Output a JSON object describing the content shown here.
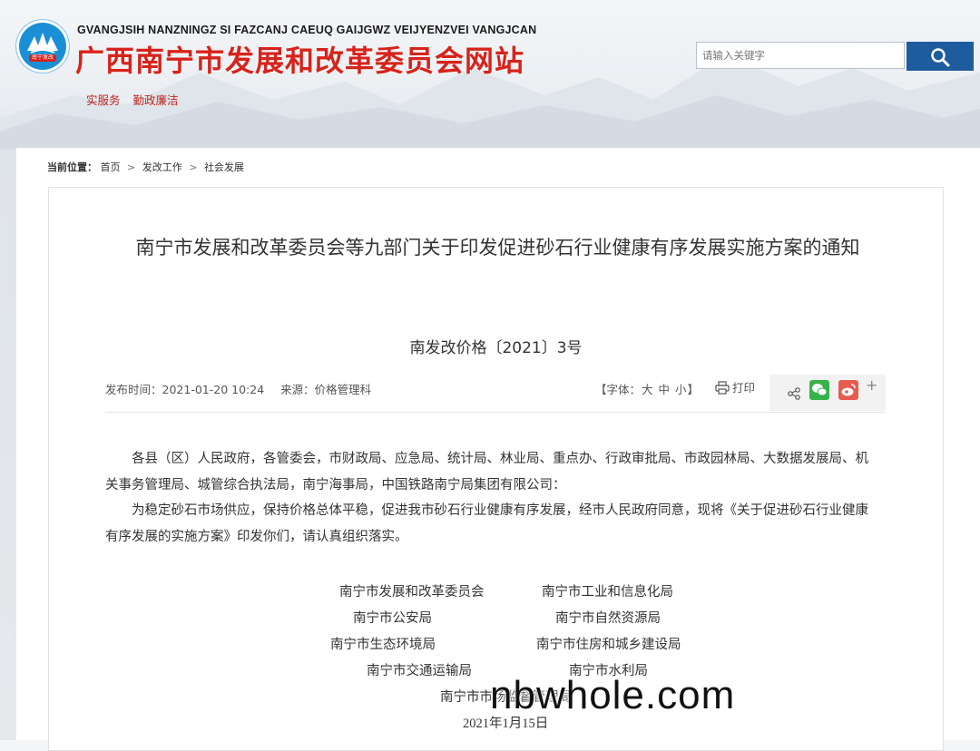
{
  "header": {
    "site_pinyin": "GVANGJSIH NANZNINGZ SI FAZCANJ CAEUQ GAIJGWZ VEIJYENZVEI VANGJCAN",
    "site_title": "广西南宁市发展和改革委员会网站",
    "logo_badge": "南宁发改",
    "links": [
      "实服务",
      "勤政廉洁"
    ],
    "search": {
      "placeholder": "请输入关键字"
    }
  },
  "breadcrumb": {
    "label": "当前位置：",
    "items": [
      "首页",
      "发改工作",
      "社会发展"
    ]
  },
  "article": {
    "title": "南宁市发展和改革委员会等九部门关于印发促进砂石行业健康有序发展实施方案的通知",
    "doc_number": "南发改价格〔2021〕3号",
    "publish_time_label": "发布时间：",
    "publish_time": "2021-01-20 10:24",
    "source_label": "来源：",
    "source": "价格管理科",
    "font_size_label": "【字体：",
    "font_size_options": [
      "大",
      "中",
      "小"
    ],
    "font_size_close": "】",
    "print_label": "打印",
    "paragraphs": [
      "各县（区）人民政府，各管委会，市财政局、应急局、统计局、林业局、重点办、行政审批局、市政园林局、大数据发展局、机关事务管理局、城管综合执法局，南宁海事局，中国铁路南宁局集团有限公司：",
      "为稳定砂石市场供应，保持价格总体平稳，促进我市砂石行业健康有序发展，经市人民政府同意，现将《关于促进砂石行业健康有序发展的实施方案》印发你们，请认真组织落实。"
    ],
    "issuers": [
      "南宁市发展和改革委员会",
      "南宁市工业和信息化局",
      "南宁市公安局",
      "南宁市自然资源局",
      "南宁市生态环境局",
      "南宁市住房和城乡建设局",
      "南宁市交通运输局",
      "南宁市水利局",
      "南宁市市场监督管理局"
    ],
    "issue_date": "2021年1月15日"
  },
  "watermark": "nbwhole.com",
  "colors": {
    "title_red": "#d6231b",
    "search_button": "#1f5c9e",
    "logo_blue": "#1b8fd6",
    "wechat_green": "#36b34a",
    "weibo_red": "#e85b4f"
  },
  "icons": {
    "search": "magnifier-icon",
    "print": "printer-icon",
    "share": "share-icon",
    "wechat": "wechat-icon",
    "weibo": "weibo-icon",
    "more": "plus-icon"
  }
}
